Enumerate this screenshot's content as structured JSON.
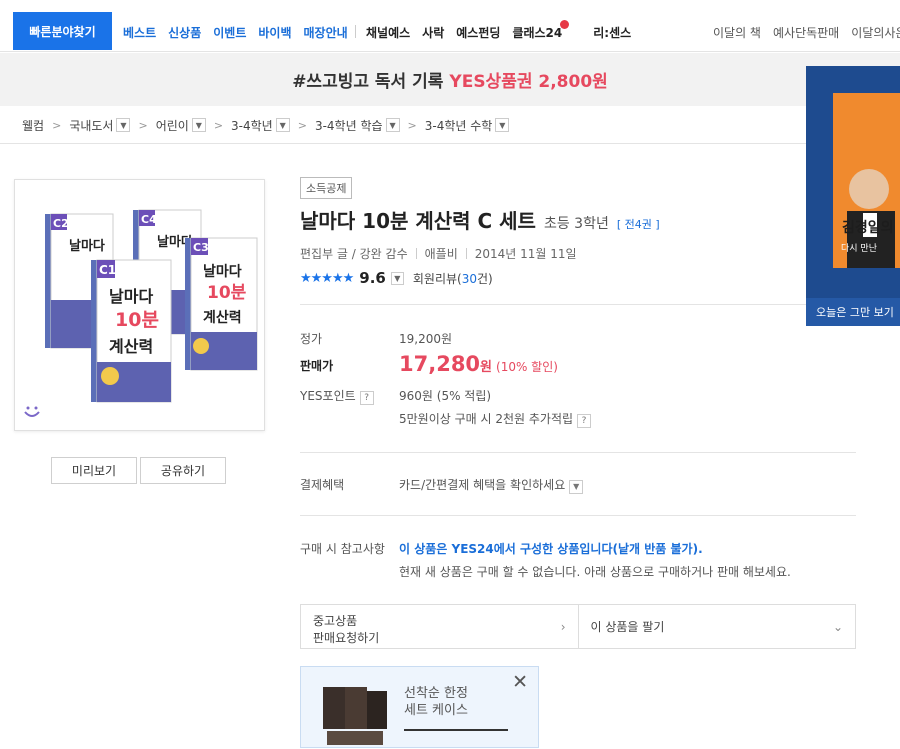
{
  "topnav": {
    "quick_find": "빠른분야찾기",
    "menu_blue": [
      "베스트",
      "신상품",
      "이벤트",
      "바이백",
      "매장안내"
    ],
    "menu_dark": [
      "채널예스",
      "사락",
      "예스펀딩",
      "클래스24",
      "리:센스"
    ],
    "menu_right": [
      "이달의 책",
      "예사단독판매",
      "이달의사은"
    ],
    "new_badge": "N"
  },
  "promo": {
    "text": "#쓰고빙고 독서 기록",
    "highlight": "YES상품권 2,800원"
  },
  "breadcrumb": {
    "home": "웰컴",
    "items": [
      "국내도서",
      "어린이",
      "3-4학년",
      "3-4학년 학습",
      "3-4학년 수학"
    ]
  },
  "product": {
    "tag": "소득공제",
    "title": "날마다 10분 계산력 C 세트",
    "subtitle": "초등 3학년",
    "volumes": "[ 전4권 ]",
    "author": "편집부 글 / 강완 감수",
    "publisher": "애플비",
    "date": "2014년 11월 11일",
    "stars": "★★★★★",
    "rating": "9.6",
    "review_label": "회원리뷰(",
    "review_count": "30",
    "review_suffix": "건)",
    "cover_books": [
      {
        "level": "C1",
        "line1": "날마다",
        "line2": "10분",
        "line3": "계산력"
      },
      {
        "level": "C2",
        "line1": "날마다",
        "line2": "10분",
        "line3": "계산력"
      },
      {
        "level": "C3",
        "line1": "날마다",
        "line2": "10분",
        "line3": "계산력"
      },
      {
        "level": "C4",
        "line1": "날마다",
        "line2": "10분",
        "line3": "계산력"
      }
    ]
  },
  "buttons": {
    "preview": "미리보기",
    "share": "공유하기"
  },
  "price": {
    "list_label": "정가",
    "list_value": "19,200원",
    "sale_label": "판매가",
    "sale_value": "17,280",
    "sale_unit": "원",
    "discount": "(10% 할인)",
    "point_label": "YES포인트",
    "point_value": "960원 (5% 적립)",
    "point_extra": "5만원이상 구매 시 2천원 추가적립",
    "help": "?"
  },
  "payment": {
    "label": "결제혜택",
    "value": "카드/간편결제 혜택을 확인하세요"
  },
  "notice": {
    "label": "구매 시 참고사항",
    "line1": "이 상품은 YES24에서 구성한 상품입니다(낱개 반품 불가).",
    "line2": "현재 새 상품은 구매 할 수 없습니다. 아래 상품으로 구매하거나 판매 해보세요."
  },
  "options": {
    "used_line1": "중고상품",
    "used_line2": "판매요청하기",
    "sell": "이 상품을 팔기"
  },
  "popup": {
    "line1": "선착순 한정",
    "line2": "세트 케이스",
    "close": "✕"
  },
  "side_ad": {
    "title": "김경일의",
    "subtitle": "다시 만난",
    "bottom": "오늘은 그만 보기"
  },
  "colors": {
    "brand_blue": "#1a73e8",
    "sale_red": "#e6495f"
  }
}
